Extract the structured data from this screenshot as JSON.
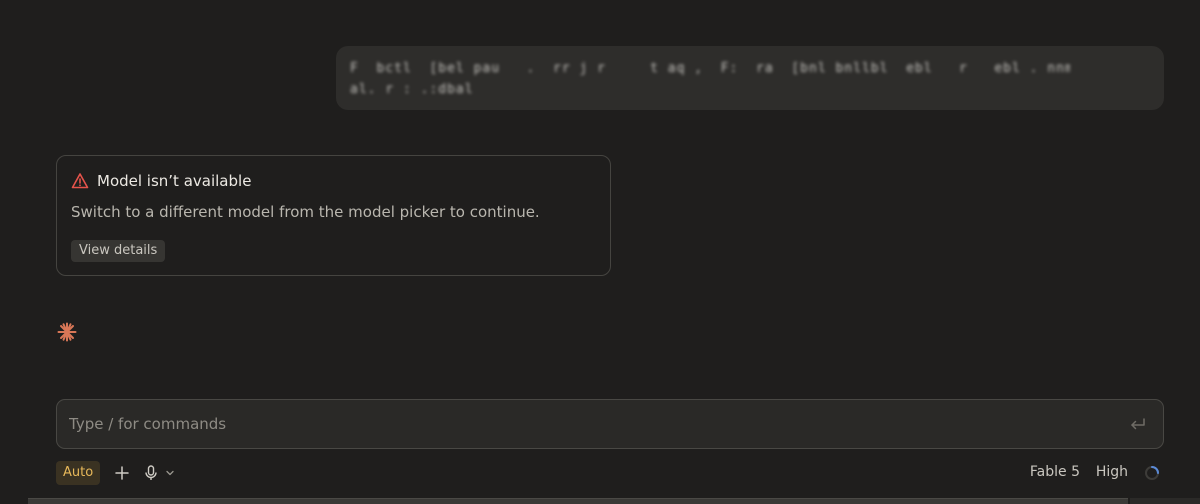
{
  "user_message": {
    "text": "F  bctl  [bel pau   .  rr j r     t aq ,  F:  ra  [bnl bnllbl  ebl   r   ebl . nnmr     l lbnrrdqylpr\nal. r : .:dbal"
  },
  "error": {
    "title": "Model isn’t available",
    "message": "Switch to a different model from the model picker to continue.",
    "details_label": "View details"
  },
  "composer": {
    "placeholder": "Type / for commands",
    "mode_label": "Auto",
    "model_label": "Fable 5",
    "effort_label": "High"
  },
  "colors": {
    "accent_spark": "#d97757",
    "error_red": "#e5534b",
    "auto_badge": "#e7b85a"
  },
  "icons": {
    "warning": "warning-triangle-icon",
    "spark": "asterisk-spark-icon",
    "enter": "enter-return-icon",
    "plus": "plus-icon",
    "mic": "microphone-icon",
    "chevron": "chevron-down-icon",
    "loading": "loading-spinner-icon"
  }
}
